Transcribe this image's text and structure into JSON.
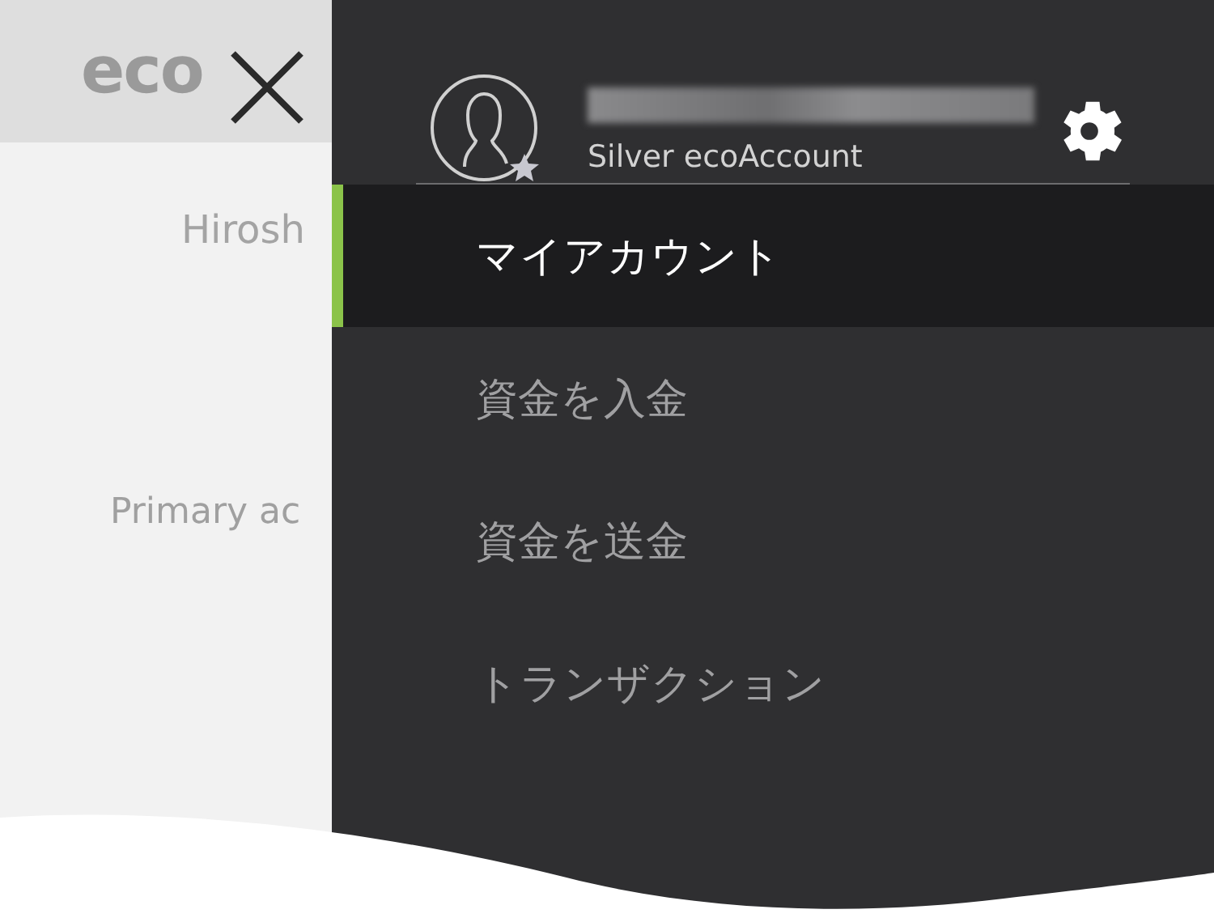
{
  "background_page": {
    "logo": "eco",
    "name": "Hirosh",
    "account_label": "Primary ac"
  },
  "drawer": {
    "account_tier": "Silver ecoAccount",
    "menu": [
      {
        "label": "マイアカウント",
        "selected": true
      },
      {
        "label": "資金を入金",
        "selected": false
      },
      {
        "label": "資金を送金",
        "selected": false
      },
      {
        "label": "トランザクション",
        "selected": false
      }
    ]
  }
}
